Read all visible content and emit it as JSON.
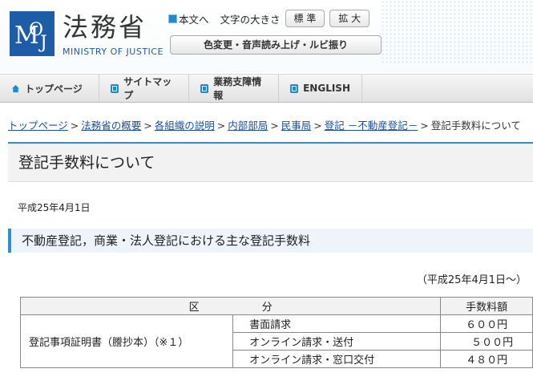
{
  "header": {
    "logo_text": "MOJ",
    "site_name": "法務省",
    "site_subtitle": "MINISTRY OF JUSTICE",
    "skip_link": "本文へ",
    "text_size_label": "文字の大きさ",
    "text_size_normal": "標 準",
    "text_size_large": "拡 大",
    "accessibility_button": "色変更・音声読み上げ・ルビ振り"
  },
  "gnav": [
    {
      "label": "トップページ",
      "icon": "home-icon"
    },
    {
      "label": "サイトマップ",
      "icon": "square-icon"
    },
    {
      "label": "業務支障情報",
      "icon": "square-icon"
    },
    {
      "label": "ENGLISH",
      "icon": "square-icon"
    }
  ],
  "breadcrumb": {
    "links": [
      "トップページ",
      "法務省の概要",
      "各組織の説明",
      "内部部局",
      "民事局",
      "登記 －不動産登記－"
    ],
    "current": "登記手数料について"
  },
  "page": {
    "title": "登記手数料について",
    "date": "平成25年4月1日",
    "section_heading": "不動産登記，商業・法人登記における主な登記手数料",
    "as_of": "（平成25年4月1日～）"
  },
  "table": {
    "header_kubun": "区　　　　　　分",
    "header_fee": "手数料額",
    "row_group_label": "登記事項証明書（謄抄本）（※１）",
    "rows": [
      {
        "method": "書面請求",
        "fee": "６００円"
      },
      {
        "method": "オンライン請求・送付",
        "fee": "５００円"
      },
      {
        "method": "オンライン請求・窓口交付",
        "fee": "４８０円"
      }
    ]
  },
  "colors": {
    "accent": "#2f8ed8",
    "logo_blue": "#1e5ca7",
    "link": "#1a4f9c"
  }
}
